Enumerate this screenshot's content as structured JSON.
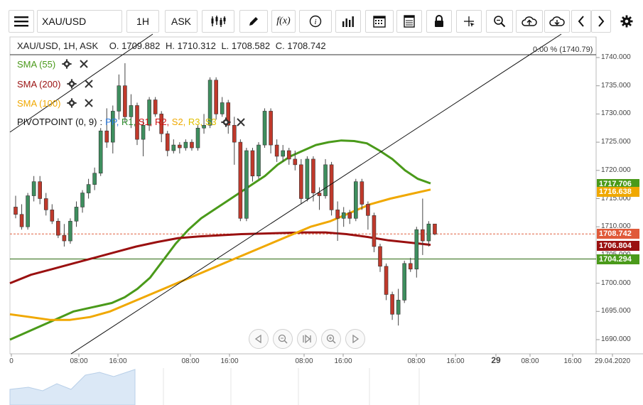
{
  "toolbar": {
    "symbol": "XAU/USD",
    "timeframe": "1H",
    "price_type": "ASK",
    "fx_label": "f(x)",
    "icons": [
      "menu-icon",
      "candlestick-icon",
      "pencil-icon",
      "function-icon",
      "info-icon",
      "bar-chart-icon",
      "calendar-icon",
      "table-icon",
      "lock-icon",
      "crosshair-icon",
      "zoom-icon",
      "cloud-upload-icon",
      "cloud-download-icon",
      "chevron-left-icon",
      "chevron-right-icon",
      "gear-icon"
    ]
  },
  "legend": {
    "ohlc_title": "XAU/USD, 1H, ASK",
    "open": "O. 1709.882",
    "high": "H. 1710.312",
    "low": "L. 1708.582",
    "close": "C. 1708.742",
    "indicators": [
      {
        "label": "SMA (55)",
        "color": "#4a9a1a"
      },
      {
        "label": "SMA (200)",
        "color": "#9a1010"
      },
      {
        "label": "SMA (100)",
        "color": "#f0a800"
      }
    ],
    "pivot": {
      "label": "PIVOTPOINT (0, 9)",
      "sep": ":",
      "tokens": [
        {
          "text": "PP",
          "color": "#2b7be0"
        },
        {
          "text": "R1",
          "color": "#2a8a2a"
        },
        {
          "text": "S1",
          "color": "#d01010"
        },
        {
          "text": "R2",
          "color": "#d01010"
        },
        {
          "text": "S2",
          "color": "#f0a800"
        },
        {
          "text": "R3",
          "color": "#e0c000"
        },
        {
          "text": "S3",
          "color": "#e0c000"
        }
      ]
    },
    "percent_label": "0.00 % (1740.79)"
  },
  "price_axis": {
    "ticks": [
      "1740.000",
      "1735.000",
      "1730.000",
      "1725.000",
      "1720.000",
      "1715.000",
      "1710.000",
      "1705.000",
      "1700.000",
      "1695.000",
      "1690.000"
    ],
    "tags": [
      {
        "text": "1717.706",
        "color": "#4a9a1a"
      },
      {
        "text": "1716.638",
        "color": "#f0a800"
      },
      {
        "text": "1708.742",
        "color": "#e05a3a"
      },
      {
        "text": "1706.804",
        "color": "#9a1010"
      },
      {
        "text": "1704.294",
        "color": "#4a9a1a"
      }
    ]
  },
  "time_axis": {
    "labels": [
      "0",
      "08:00",
      "16:00",
      "08:00",
      "16:00",
      "08:00",
      "16:00",
      "08:00",
      "16:00",
      "29",
      "08:00",
      "16:00",
      "29.04.2020"
    ]
  },
  "chart_data": {
    "type": "candlestick",
    "ylim": [
      1688,
      1743
    ],
    "candles": [
      [
        1713.5,
        1715.5,
        1711.5,
        1712.2
      ],
      [
        1712.2,
        1714.0,
        1709.5,
        1710.0
      ],
      [
        1710.0,
        1716.0,
        1709.5,
        1715.5
      ],
      [
        1715.5,
        1719.0,
        1714.5,
        1718.0
      ],
      [
        1718.0,
        1719.0,
        1714.0,
        1715.0
      ],
      [
        1715.0,
        1716.0,
        1712.0,
        1713.0
      ],
      [
        1713.0,
        1714.0,
        1710.5,
        1711.0
      ],
      [
        1711.0,
        1711.5,
        1708.0,
        1708.5
      ],
      [
        1708.5,
        1710.5,
        1706.5,
        1707.5
      ],
      [
        1707.5,
        1711.5,
        1707.0,
        1711.0
      ],
      [
        1711.0,
        1714.5,
        1710.0,
        1713.5
      ],
      [
        1713.5,
        1716.5,
        1712.5,
        1716.0
      ],
      [
        1716.0,
        1718.5,
        1715.0,
        1717.5
      ],
      [
        1717.5,
        1720.5,
        1716.5,
        1719.5
      ],
      [
        1719.5,
        1727.5,
        1719.0,
        1727.0
      ],
      [
        1727.0,
        1731.0,
        1724.0,
        1725.0
      ],
      [
        1725.0,
        1731.5,
        1723.0,
        1730.5
      ],
      [
        1730.5,
        1737.0,
        1729.0,
        1735.0
      ],
      [
        1735.0,
        1739.0,
        1728.5,
        1729.5
      ],
      [
        1729.5,
        1733.5,
        1727.5,
        1731.5
      ],
      [
        1731.5,
        1732.0,
        1724.5,
        1725.5
      ],
      [
        1725.5,
        1729.0,
        1722.5,
        1728.0
      ],
      [
        1728.0,
        1733.0,
        1727.0,
        1732.5
      ],
      [
        1732.5,
        1733.0,
        1729.5,
        1730.0
      ],
      [
        1730.0,
        1730.5,
        1725.0,
        1726.5
      ],
      [
        1726.5,
        1727.0,
        1722.5,
        1723.5
      ],
      [
        1723.5,
        1725.5,
        1723.0,
        1724.5
      ],
      [
        1724.5,
        1725.0,
        1723.0,
        1724.0
      ],
      [
        1724.0,
        1725.5,
        1723.5,
        1725.0
      ],
      [
        1725.0,
        1725.5,
        1723.5,
        1724.0
      ],
      [
        1724.0,
        1728.0,
        1723.5,
        1727.5
      ],
      [
        1727.5,
        1730.0,
        1726.5,
        1728.0
      ],
      [
        1728.0,
        1736.5,
        1727.5,
        1736.0
      ],
      [
        1736.0,
        1736.5,
        1729.0,
        1730.0
      ],
      [
        1730.0,
        1733.0,
        1729.5,
        1732.0
      ],
      [
        1732.0,
        1732.5,
        1726.5,
        1728.0
      ],
      [
        1728.0,
        1729.5,
        1721.0,
        1725.0
      ],
      [
        1725.0,
        1725.5,
        1711.0,
        1711.5
      ],
      [
        1711.5,
        1724.0,
        1711.0,
        1723.5
      ],
      [
        1723.5,
        1724.0,
        1718.0,
        1719.0
      ],
      [
        1719.0,
        1725.0,
        1718.5,
        1724.5
      ],
      [
        1724.5,
        1731.0,
        1724.0,
        1730.5
      ],
      [
        1730.5,
        1731.0,
        1723.0,
        1724.5
      ],
      [
        1724.5,
        1725.5,
        1721.5,
        1722.5
      ],
      [
        1722.5,
        1724.5,
        1721.5,
        1723.5
      ],
      [
        1723.5,
        1724.0,
        1721.0,
        1722.0
      ],
      [
        1722.0,
        1723.5,
        1720.0,
        1721.0
      ],
      [
        1721.0,
        1722.0,
        1714.0,
        1715.0
      ],
      [
        1715.0,
        1722.5,
        1714.5,
        1722.0
      ],
      [
        1722.0,
        1722.5,
        1714.5,
        1716.0
      ],
      [
        1716.0,
        1717.0,
        1713.0,
        1715.5
      ],
      [
        1715.5,
        1722.0,
        1715.0,
        1721.0
      ],
      [
        1721.0,
        1721.5,
        1712.0,
        1713.0
      ],
      [
        1713.0,
        1714.5,
        1707.5,
        1711.5
      ],
      [
        1711.5,
        1713.5,
        1710.0,
        1712.5
      ],
      [
        1712.5,
        1713.0,
        1710.5,
        1711.5
      ],
      [
        1711.5,
        1718.5,
        1711.0,
        1718.0
      ],
      [
        1718.0,
        1718.5,
        1713.0,
        1714.0
      ],
      [
        1714.0,
        1714.5,
        1709.5,
        1712.0
      ],
      [
        1712.0,
        1712.5,
        1705.5,
        1706.5
      ],
      [
        1706.5,
        1707.0,
        1702.0,
        1703.0
      ],
      [
        1703.0,
        1703.5,
        1697.0,
        1698.0
      ],
      [
        1698.0,
        1698.5,
        1693.5,
        1694.5
      ],
      [
        1694.5,
        1699.0,
        1692.5,
        1697.0
      ],
      [
        1697.0,
        1704.0,
        1696.5,
        1703.5
      ],
      [
        1703.5,
        1704.5,
        1702.0,
        1702.5
      ],
      [
        1702.5,
        1710.0,
        1701.0,
        1709.5
      ],
      [
        1709.5,
        1715.0,
        1705.0,
        1707.5
      ],
      [
        1707.5,
        1711.0,
        1706.5,
        1710.5
      ],
      [
        1710.5,
        1710.5,
        1708.5,
        1708.7
      ]
    ],
    "horizontal_lines": [
      1708.742,
      1704.294,
      1740.79
    ],
    "series": [
      {
        "name": "SMA (55)",
        "color": "#4a9a1a",
        "values": [
          1690,
          1691,
          1692,
          1693,
          1694,
          1695,
          1695.5,
          1696,
          1696.5,
          1697.5,
          1699,
          1701,
          1704,
          1707,
          1709.5,
          1711.5,
          1713,
          1714.5,
          1716,
          1717.5,
          1719,
          1721,
          1722.5,
          1723.5,
          1724.5,
          1725,
          1725.3,
          1725.2,
          1724.8,
          1723.5,
          1722,
          1720,
          1718.5,
          1717.7
        ]
      },
      {
        "name": "SMA (200)",
        "color": "#9a1010",
        "values": [
          1700,
          1701.5,
          1702.5,
          1703.5,
          1704.5,
          1705.5,
          1706.5,
          1707.3,
          1708,
          1708.3,
          1708.5,
          1708.7,
          1708.8,
          1708.9,
          1709,
          1709,
          1708.7,
          1708.2,
          1707.6,
          1707.2,
          1706.8
        ]
      },
      {
        "name": "SMA (100)",
        "color": "#f0a800",
        "values": [
          1694.5,
          1694,
          1693.5,
          1693.5,
          1694,
          1695,
          1696.5,
          1698,
          1699.5,
          1701,
          1702.5,
          1704,
          1705.5,
          1707,
          1708.5,
          1710,
          1711,
          1712.5,
          1714,
          1715,
          1715.8,
          1716.6
        ]
      }
    ],
    "trendline": [
      [
        1688,
        1742
      ]
    ]
  }
}
